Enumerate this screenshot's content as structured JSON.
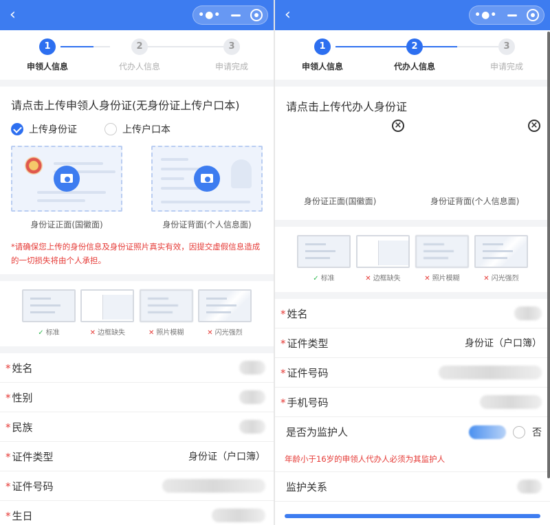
{
  "left": {
    "steps": [
      {
        "num": "1",
        "label": "申领人信息"
      },
      {
        "num": "2",
        "label": "代办人信息"
      },
      {
        "num": "3",
        "label": "申请完成"
      }
    ],
    "upload_title": "请点击上传申领人身份证(无身份证上传户口本)",
    "radio_id": "上传身份证",
    "radio_hukou": "上传户口本",
    "card_front": "身份证正面(国徽面)",
    "card_back": "身份证背面(个人信息面)",
    "warning": "*请确保您上传的身份信息及身份证照片真实有效，因提交虚假信息造成的一切损失将由个人承担。",
    "samples": [
      {
        "mark": "✓",
        "label": "标准"
      },
      {
        "mark": "✕",
        "label": "边框缺失"
      },
      {
        "mark": "✕",
        "label": "照片模糊"
      },
      {
        "mark": "✕",
        "label": "闪光强烈"
      }
    ],
    "fields": [
      {
        "label": "姓名",
        "value": ""
      },
      {
        "label": "性别",
        "value": ""
      },
      {
        "label": "民族",
        "value": ""
      },
      {
        "label": "证件类型",
        "value": "身份证（户口簿）"
      },
      {
        "label": "证件号码",
        "value": ""
      },
      {
        "label": "生日",
        "value": ""
      }
    ]
  },
  "right": {
    "steps": [
      {
        "num": "1",
        "label": "申领人信息"
      },
      {
        "num": "2",
        "label": "代办人信息"
      },
      {
        "num": "3",
        "label": "申请完成"
      }
    ],
    "upload_title": "请点击上传代办人身份证",
    "card_front": "身份证正面(国徽面)",
    "card_back": "身份证背面(个人信息面)",
    "samples": [
      {
        "mark": "✓",
        "label": "标准"
      },
      {
        "mark": "✕",
        "label": "边框缺失"
      },
      {
        "mark": "✕",
        "label": "照片模糊"
      },
      {
        "mark": "✕",
        "label": "闪光强烈"
      }
    ],
    "fields": [
      {
        "label": "姓名",
        "value": ""
      },
      {
        "label": "证件类型",
        "value": "身份证（户口簿）"
      },
      {
        "label": "证件号码",
        "value": ""
      },
      {
        "label": "手机号码",
        "value": ""
      }
    ],
    "guardian_label": "是否为监护人",
    "guardian_yes": "是",
    "guardian_no": "否",
    "guardian_warning": "年龄小于16岁的申领人代办人必须为其监护人",
    "relation_label": "监护关系"
  },
  "colors": {
    "primary": "#3d7cf0",
    "warning": "#e53935",
    "ok": "#2db84d"
  }
}
